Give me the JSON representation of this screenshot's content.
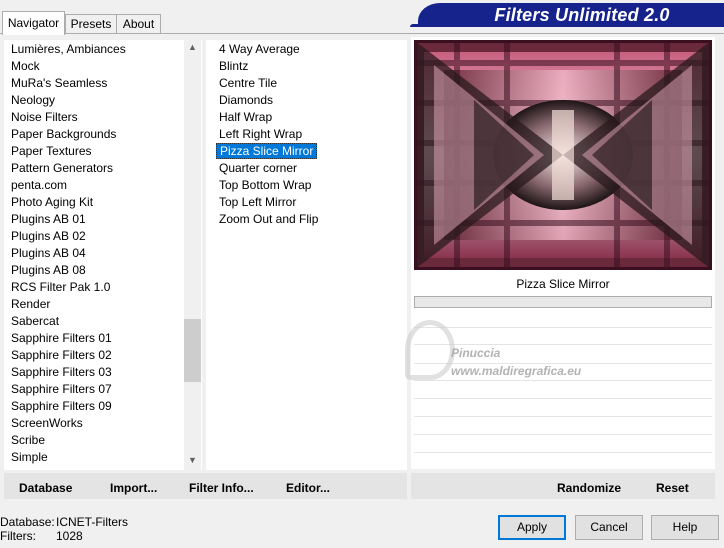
{
  "tabs": [
    "Navigator",
    "Presets",
    "About"
  ],
  "banner": "Filters Unlimited 2.0",
  "categories": [
    "Lumières, Ambiances",
    "Mock",
    "MuRa's Seamless",
    "Neology",
    "Noise Filters",
    "Paper Backgrounds",
    "Paper Textures",
    "Pattern Generators",
    "penta.com",
    "Photo Aging Kit",
    "Plugins AB 01",
    "Plugins AB 02",
    "Plugins AB 04",
    "Plugins AB 08",
    "RCS Filter Pak 1.0",
    "Render",
    "Sabercat",
    "Sapphire Filters 01",
    "Sapphire Filters 02",
    "Sapphire Filters 03",
    "Sapphire Filters 07",
    "Sapphire Filters 09",
    "ScreenWorks",
    "Scribe",
    "Simple"
  ],
  "filters": [
    "4 Way Average",
    "Blintz",
    "Centre Tile",
    "Diamonds",
    "Half Wrap",
    "Left Right Wrap",
    "Pizza Slice Mirror",
    "Quarter corner",
    "Top Bottom Wrap",
    "Top Left Mirror",
    "Zoom Out and Flip"
  ],
  "selected_filter": "Pizza Slice Mirror",
  "preview_caption": "Pizza Slice Mirror",
  "watermark": {
    "line1": "Pinuccia",
    "line2": "www.maldiregrafica.eu"
  },
  "buttons": {
    "database": "Database",
    "import": "Import...",
    "filter_info": "Filter Info...",
    "editor": "Editor...",
    "randomize": "Randomize",
    "reset": "Reset",
    "apply": "Apply",
    "cancel": "Cancel",
    "help": "Help"
  },
  "status": {
    "database_label": "Database:",
    "database_value": "ICNET-Filters",
    "filters_label": "Filters:",
    "filters_value": "1028"
  },
  "icons": {
    "scroll_up": "▲",
    "scroll_down": "▼"
  },
  "colors": {
    "banner": "#16238c",
    "selection": "#0078d7"
  }
}
